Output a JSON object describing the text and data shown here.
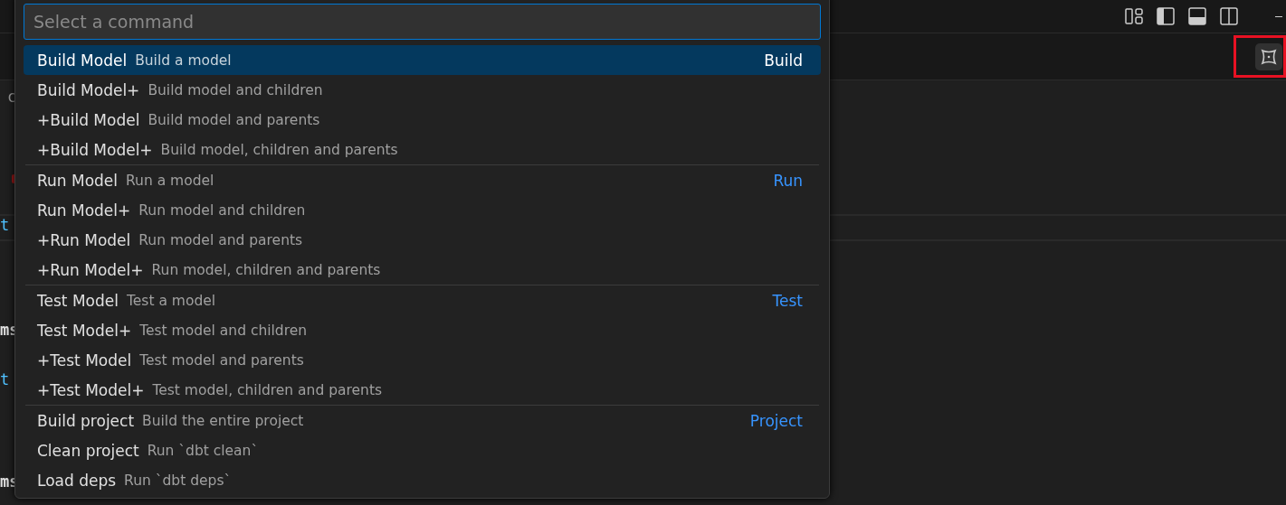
{
  "editor_fragments": [
    {
      "text": "c",
      "kind": "comment"
    },
    {
      "text": "t",
      "kind": "keyword"
    },
    {
      "text": "ms",
      "kind": "plain"
    },
    {
      "text": "t",
      "kind": "keyword"
    },
    {
      "text": "ms",
      "kind": "plain"
    }
  ],
  "command_palette": {
    "placeholder": "Select a command",
    "groups": [
      {
        "items": [
          {
            "label": "Build Model",
            "description": "Build a model",
            "category": "Build",
            "selected": true
          },
          {
            "label": "Build Model+",
            "description": "Build model and children",
            "selected": false
          },
          {
            "label": "+Build Model",
            "description": "Build model and parents",
            "selected": false
          },
          {
            "label": "+Build Model+",
            "description": "Build model, children and parents",
            "selected": false
          }
        ]
      },
      {
        "items": [
          {
            "label": "Run Model",
            "description": "Run a model",
            "category": "Run",
            "selected": false
          },
          {
            "label": "Run Model+",
            "description": "Run model and children",
            "selected": false
          },
          {
            "label": "+Run Model",
            "description": "Run model and parents",
            "selected": false
          },
          {
            "label": "+Run Model+",
            "description": "Run model, children and parents",
            "selected": false
          }
        ]
      },
      {
        "items": [
          {
            "label": "Test Model",
            "description": "Test a model",
            "category": "Test",
            "selected": false
          },
          {
            "label": "Test Model+",
            "description": "Test model and children",
            "selected": false
          },
          {
            "label": "+Test Model",
            "description": "Test model and parents",
            "selected": false
          },
          {
            "label": "+Test Model+",
            "description": "Test model, children and parents",
            "selected": false
          }
        ]
      },
      {
        "items": [
          {
            "label": "Build project",
            "description": "Build the entire project",
            "category": "Project",
            "selected": false
          },
          {
            "label": "Clean project",
            "description": "Run `dbt clean`",
            "selected": false
          },
          {
            "label": "Load deps",
            "description": "Run `dbt deps`",
            "selected": false
          }
        ]
      }
    ]
  }
}
